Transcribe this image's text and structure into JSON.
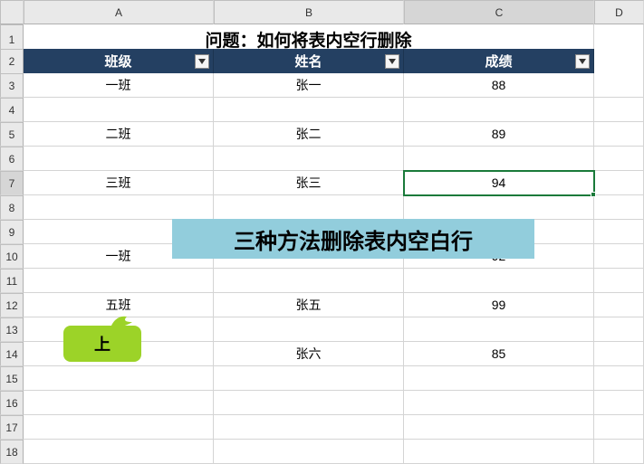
{
  "columns": [
    "A",
    "B",
    "C",
    "D"
  ],
  "row_numbers": [
    1,
    2,
    3,
    4,
    5,
    6,
    7,
    8,
    9,
    10,
    11,
    12,
    13,
    14,
    15,
    16,
    17,
    18
  ],
  "title": "问题：如何将表内空行删除",
  "headers": {
    "col_a": "班级",
    "col_b": "姓名",
    "col_c": "成绩"
  },
  "rows": [
    {
      "a": "一班",
      "b": "张一",
      "c": "88"
    },
    {
      "a": "",
      "b": "",
      "c": ""
    },
    {
      "a": "二班",
      "b": "张二",
      "c": "89"
    },
    {
      "a": "",
      "b": "",
      "c": ""
    },
    {
      "a": "三班",
      "b": "张三",
      "c": "94"
    },
    {
      "a": "",
      "b": "",
      "c": ""
    },
    {
      "a": "",
      "b": "",
      "c": ""
    },
    {
      "a": "一班",
      "b": "",
      "c": "92"
    },
    {
      "a": "",
      "b": "",
      "c": ""
    },
    {
      "a": "五班",
      "b": "张五",
      "c": "99"
    },
    {
      "a": "",
      "b": "",
      "c": ""
    },
    {
      "a": "",
      "b": "张六",
      "c": "85"
    },
    {
      "a": "",
      "b": "",
      "c": ""
    },
    {
      "a": "",
      "b": "",
      "c": ""
    },
    {
      "a": "",
      "b": "",
      "c": ""
    },
    {
      "a": "",
      "b": "",
      "c": ""
    }
  ],
  "selected_cell": {
    "row": 7,
    "col": "C"
  },
  "annotation_text": "三种方法删除表内空白行",
  "callout_text": "上"
}
